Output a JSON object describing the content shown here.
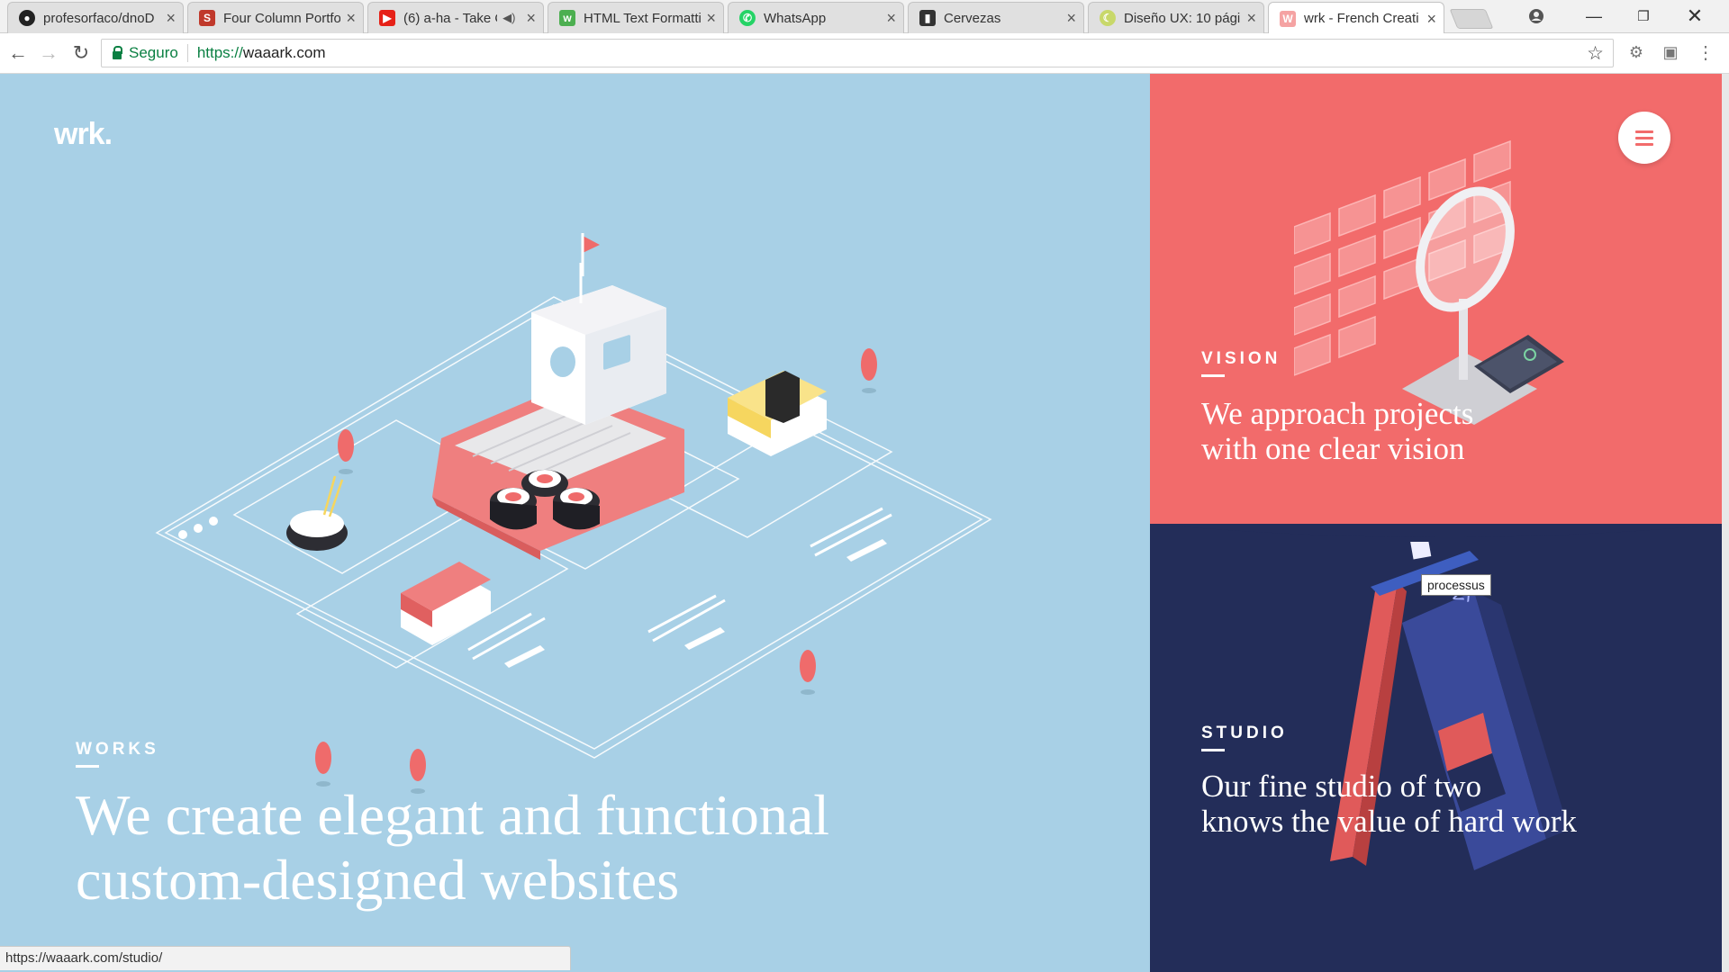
{
  "browser": {
    "tabs": [
      {
        "title": "profesorfaco/dnoD",
        "favicon": "github-icon",
        "active": false
      },
      {
        "title": "Four Column Portfo",
        "favicon": "s-icon",
        "active": false
      },
      {
        "title": "(6) a-ha - Take On",
        "favicon": "youtube-icon",
        "active": false,
        "audio": true
      },
      {
        "title": "HTML Text Formatti",
        "favicon": "w3-icon",
        "active": false
      },
      {
        "title": "WhatsApp",
        "favicon": "whatsapp-icon",
        "active": false
      },
      {
        "title": "Cervezas",
        "favicon": "beer-icon",
        "active": false
      },
      {
        "title": "Diseño UX: 10 pági",
        "favicon": "crescent-icon",
        "active": false
      },
      {
        "title": "wrk - French Creati",
        "favicon": "wrk-icon",
        "active": true
      }
    ],
    "address": {
      "security_label": "Seguro",
      "scheme": "https://",
      "host": "waaark.com"
    },
    "status_url": "https://waaark.com/studio/"
  },
  "site": {
    "logo": "wrk.",
    "tooltip": "processus",
    "works": {
      "label": "WORKS",
      "headline_line1": "We create elegant and functional",
      "headline_line2": "custom-designed websites"
    },
    "vision": {
      "label": "VISION",
      "headline_line1": "We approach projects",
      "headline_line2": "with one clear vision"
    },
    "studio": {
      "label": "STUDIO",
      "headline_line1": "Our fine studio of two",
      "headline_line2": "knows the value of hard work"
    }
  },
  "colors": {
    "works_bg": "#a8d0e6",
    "vision_bg": "#f26b6b",
    "studio_bg": "#232d59",
    "accent": "#f26b6b"
  }
}
